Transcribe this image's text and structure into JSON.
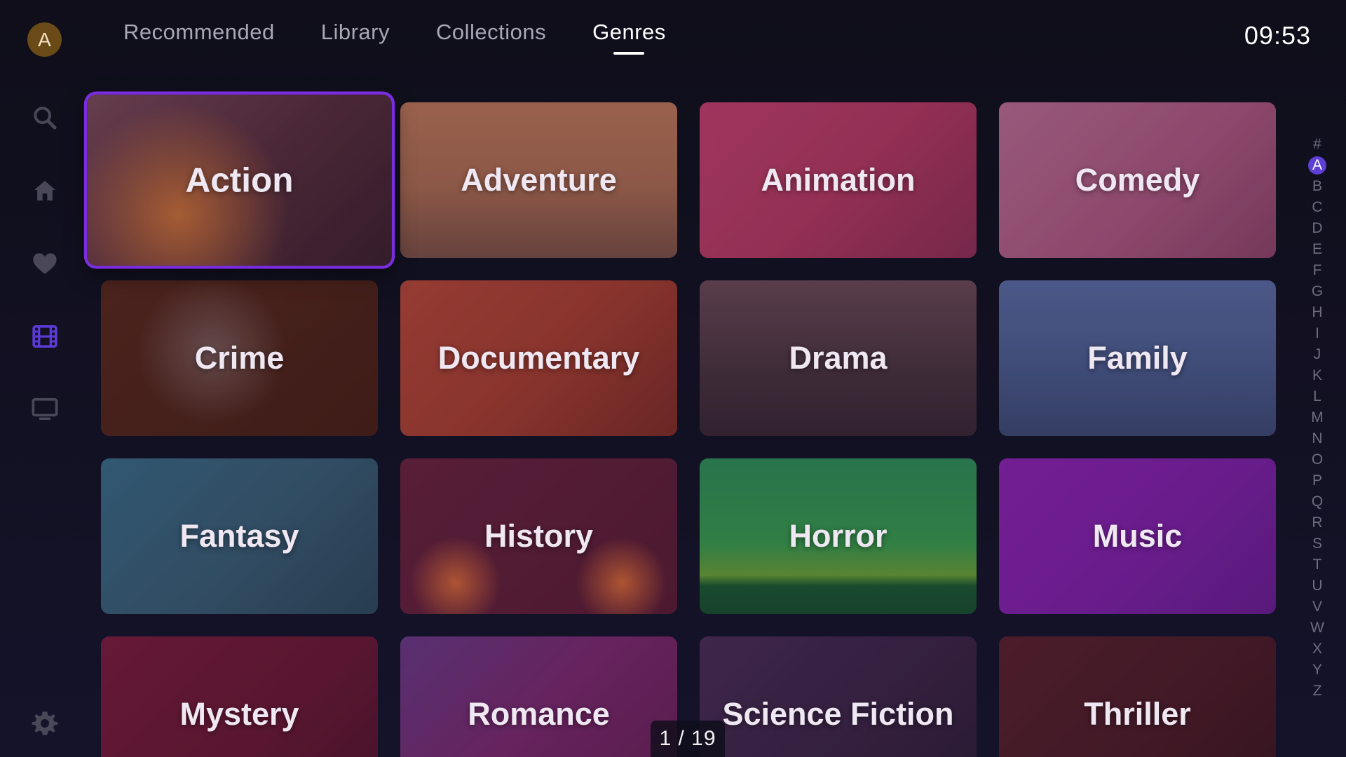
{
  "header": {
    "avatar_letter": "A",
    "tabs": [
      {
        "label": "Recommended",
        "active": false
      },
      {
        "label": "Library",
        "active": false
      },
      {
        "label": "Collections",
        "active": false
      },
      {
        "label": "Genres",
        "active": true
      }
    ],
    "clock": "09:53"
  },
  "rail": {
    "items": [
      {
        "icon": "search-icon"
      },
      {
        "icon": "home-icon"
      },
      {
        "icon": "heart-icon"
      },
      {
        "icon": "film-icon",
        "active": true
      },
      {
        "icon": "tv-icon"
      },
      {
        "icon": "gear-icon"
      }
    ],
    "active_color": "#5b3bd6",
    "inactive_color": "#4a4858"
  },
  "genres": [
    {
      "label": "Action",
      "focused": true
    },
    {
      "label": "Adventure"
    },
    {
      "label": "Animation"
    },
    {
      "label": "Comedy"
    },
    {
      "label": "Crime"
    },
    {
      "label": "Documentary"
    },
    {
      "label": "Drama"
    },
    {
      "label": "Family"
    },
    {
      "label": "Fantasy"
    },
    {
      "label": "History"
    },
    {
      "label": "Horror"
    },
    {
      "label": "Music"
    },
    {
      "label": "Mystery"
    },
    {
      "label": "Romance"
    },
    {
      "label": "Science Fiction"
    },
    {
      "label": "Thriller"
    }
  ],
  "alphabet": {
    "letters": [
      "#",
      "A",
      "B",
      "C",
      "D",
      "E",
      "F",
      "G",
      "H",
      "I",
      "J",
      "K",
      "L",
      "M",
      "N",
      "O",
      "P",
      "Q",
      "R",
      "S",
      "T",
      "U",
      "V",
      "W",
      "X",
      "Y",
      "Z"
    ],
    "active": "A"
  },
  "pager": {
    "text": "1 / 19"
  },
  "colors": {
    "focus_ring": "#7a2de0",
    "alphabet_active": "#5d3fd3"
  }
}
